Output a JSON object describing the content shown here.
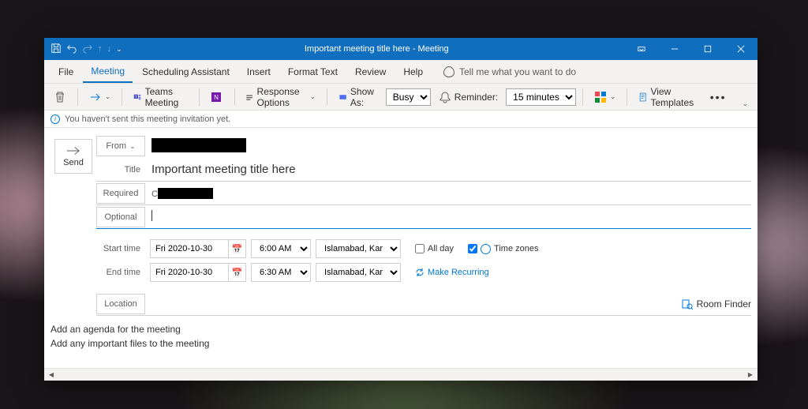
{
  "titlebar": {
    "title": "Important meeting title here  -  Meeting"
  },
  "tabs": {
    "file": "File",
    "meeting": "Meeting",
    "scheduling": "Scheduling Assistant",
    "insert": "Insert",
    "format": "Format Text",
    "review": "Review",
    "help": "Help",
    "tellme": "Tell me what you want to do"
  },
  "ribbon": {
    "teams": "Teams Meeting",
    "response": "Response Options",
    "showas_label": "Show As:",
    "showas_value": "Busy",
    "reminder_label": "Reminder:",
    "reminder_value": "15 minutes",
    "templates": "View Templates"
  },
  "infobar": "You haven't sent this meeting invitation yet.",
  "labels": {
    "send": "Send",
    "from": "From",
    "title": "Title",
    "required": "Required",
    "optional": "Optional",
    "start": "Start time",
    "end": "End time",
    "location": "Location",
    "allday": "All day",
    "timezones": "Time zones",
    "recurring": "Make Recurring",
    "roomfinder": "Room Finder"
  },
  "values": {
    "title": "Important meeting title here",
    "start_date": "Fri 2020-10-30",
    "start_time": "6:00 AM",
    "start_tz": "Islamabad, Karachi",
    "end_date": "Fri 2020-10-30",
    "end_time": "6:30 AM",
    "end_tz": "Islamabad, Karachi",
    "allday_checked": false,
    "timezones_checked": true
  },
  "body": {
    "line1": "Add an agenda for the meeting",
    "line2": "Add any important files to the meeting"
  }
}
